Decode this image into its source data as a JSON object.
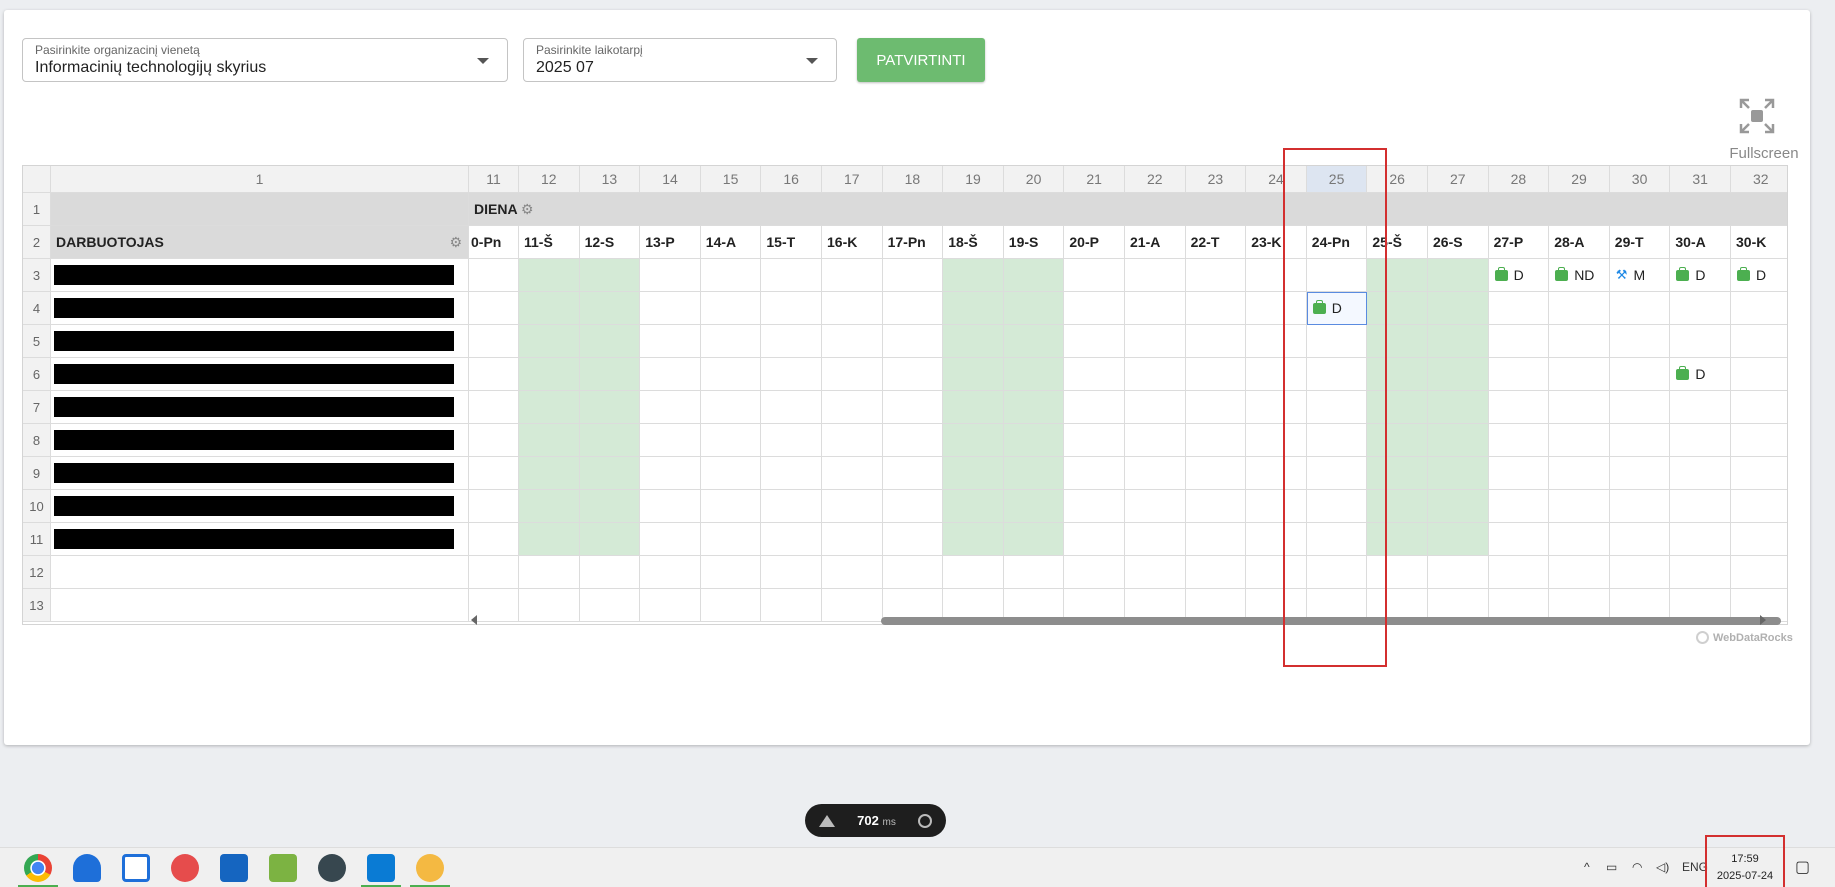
{
  "filters": {
    "org_label": "Pasirinkite organizacinį vienetą",
    "org_value": "Informacinių technologijų skyrius",
    "period_label": "Pasirinkite laikotarpį",
    "period_value": "2025 07",
    "confirm_label": "PATVIRTINTI"
  },
  "fullscreen_label": "Fullscreen",
  "grid": {
    "first_col_header": "1",
    "col_headers": [
      "11",
      "12",
      "13",
      "14",
      "15",
      "16",
      "17",
      "18",
      "19",
      "20",
      "21",
      "22",
      "23",
      "24",
      "25",
      "26",
      "27",
      "28",
      "29",
      "30",
      "31",
      "32"
    ],
    "selected_col": "25",
    "row_numbers": [
      "1",
      "2",
      "3",
      "4",
      "5",
      "6",
      "7",
      "8",
      "9",
      "10",
      "11",
      "12",
      "13"
    ],
    "diena_label": "DIENA",
    "employee_header": "DARBUOTOJAS",
    "day_headers": [
      "0-Pn",
      "11-Š",
      "12-S",
      "13-P",
      "14-A",
      "15-T",
      "16-K",
      "17-Pn",
      "18-Š",
      "19-S",
      "20-P",
      "21-A",
      "22-T",
      "23-K",
      "24-Pn",
      "25-Š",
      "26-S",
      "27-P",
      "28-A",
      "29-T",
      "30-A",
      "30-K"
    ],
    "weekend_cols": [
      1,
      2,
      8,
      9,
      15,
      16
    ],
    "employee_rows": 9,
    "entries": [
      {
        "row": 0,
        "col": 17,
        "icon": "briefcase-icon",
        "text": "D"
      },
      {
        "row": 0,
        "col": 18,
        "icon": "briefcase-icon",
        "text": "ND"
      },
      {
        "row": 0,
        "col": 19,
        "icon": "tool-icon",
        "text": "M"
      },
      {
        "row": 0,
        "col": 20,
        "icon": "briefcase-icon",
        "text": "D"
      },
      {
        "row": 0,
        "col": 21,
        "icon": "briefcase-icon",
        "text": "D"
      },
      {
        "row": 1,
        "col": 14,
        "icon": "briefcase-icon",
        "text": "D",
        "selected": true
      },
      {
        "row": 3,
        "col": 20,
        "icon": "briefcase-icon",
        "text": "D"
      }
    ]
  },
  "branding": "WebDataRocks",
  "perf": {
    "value": "702",
    "unit": "ms"
  },
  "taskbar": {
    "icons": [
      "chrome-icon",
      "onedrive-icon",
      "security-icon",
      "app-icon",
      "photos-icon",
      "notepad-icon",
      "network-icon",
      "vscode-icon",
      "paint-icon"
    ],
    "language": "ENG",
    "time": "17:59",
    "date": "2025-07-24"
  }
}
